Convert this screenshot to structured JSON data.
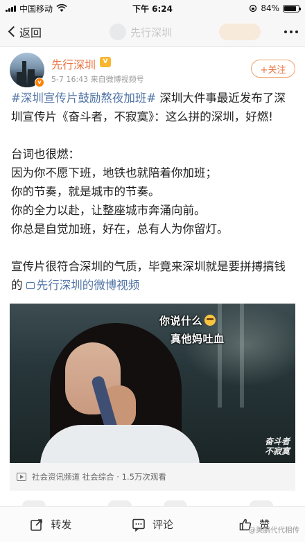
{
  "status_bar": {
    "carrier": "中国移动",
    "time": "下午 6:24",
    "battery_text": "84%",
    "battery_level": 0.84
  },
  "nav": {
    "back_label": "返回",
    "faded_title": "先行深圳"
  },
  "author": {
    "name": "先行深圳",
    "vip_badge": "V",
    "verified_badge": "v",
    "meta": "5-7 16:43  来自微博视频号",
    "follow_label": "+关注"
  },
  "post": {
    "hashtag": "#深圳宣传片鼓励熬夜加班#",
    "para1_rest": " 深圳大件事最近发布了深圳宣传片《奋斗者，不寂寞》：这么拼的深圳，好燃!",
    "lines_heading": "台词也很燃：",
    "lines": [
      "因为你不愿下班，地铁也就陪着你加班；",
      "你的节奏，就是城市的节奏。",
      "你的全力以赴，让整座城市奔涌向前。",
      "你总是自觉加班，好在，总有人为你留灯。"
    ],
    "closing_text": "宣传片很符合深圳的气质，毕竟来深圳就是要拼搏搞钱的 ",
    "video_link": "先行深圳的微博视频"
  },
  "video": {
    "subtitle_1": "你说什么",
    "subtitle_2": "真他妈吐血",
    "watermark_line1": "奋斗者",
    "watermark_line2": "不寂寞",
    "meta": "社会资讯频道 社会综合 · 1.5万次观看"
  },
  "actions": {
    "repost": "转发",
    "comment": "评论",
    "like": "赞"
  },
  "footer_watermark": "@美鹏代代相传"
}
